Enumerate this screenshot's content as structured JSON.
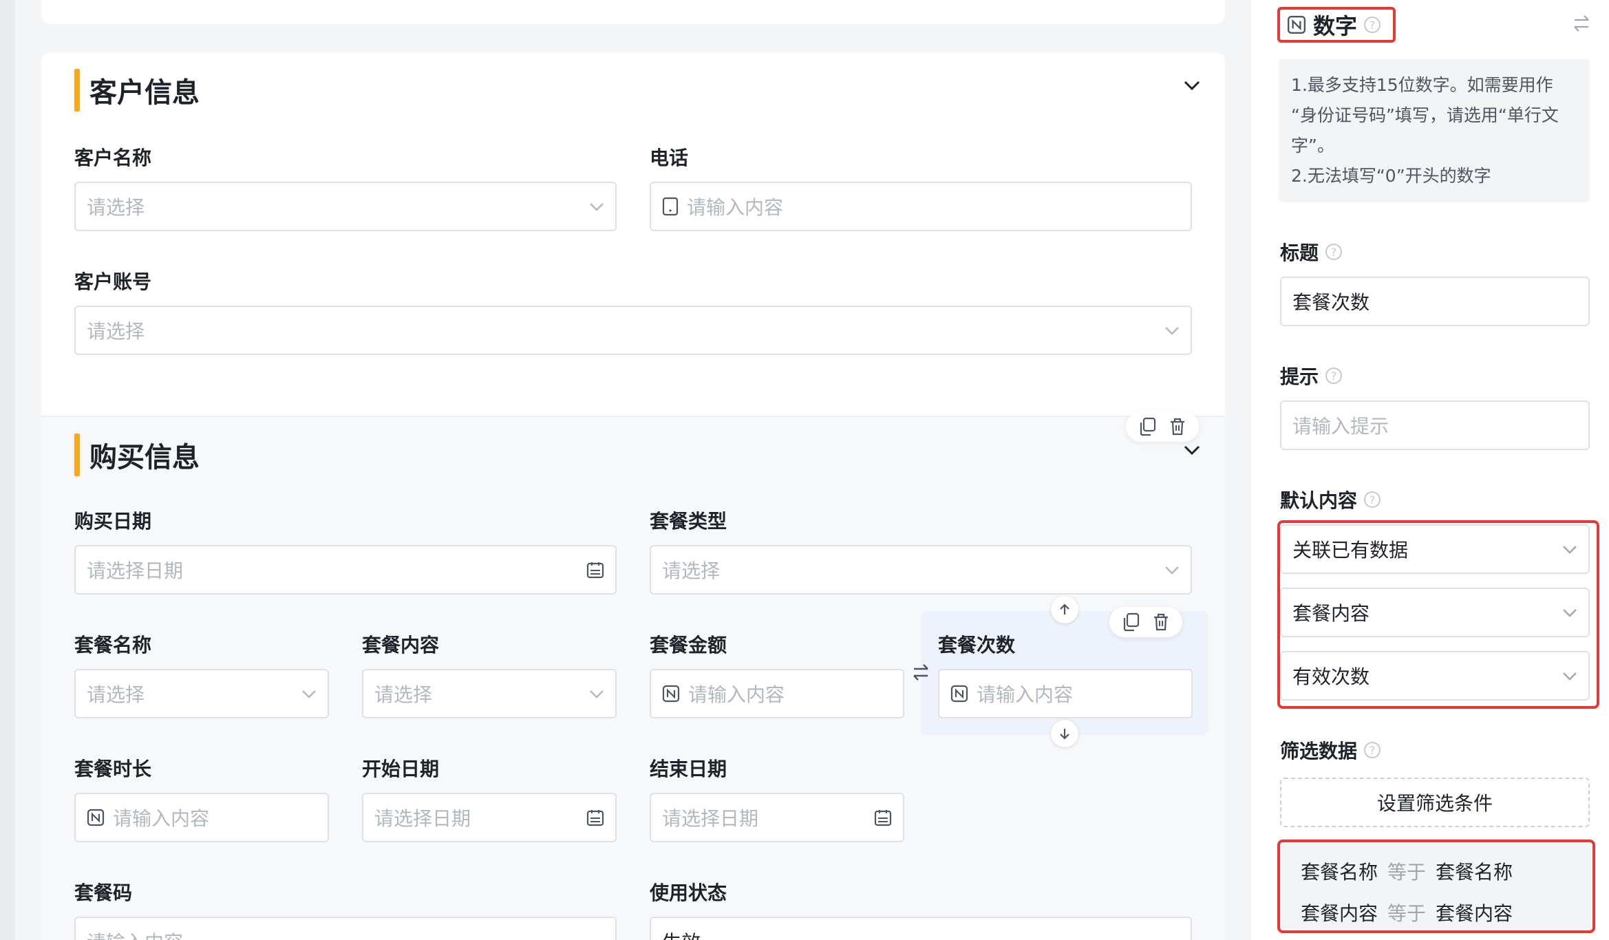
{
  "customer_section": {
    "title": "客户信息",
    "fields": {
      "customer_name": {
        "label": "客户名称",
        "placeholder": "请选择"
      },
      "phone": {
        "label": "电话",
        "placeholder": "请输入内容"
      },
      "customer_account": {
        "label": "客户账号",
        "placeholder": "请选择"
      }
    }
  },
  "purchase_section": {
    "title": "购买信息",
    "fields": {
      "purchase_date": {
        "label": "购买日期",
        "placeholder": "请选择日期"
      },
      "package_type": {
        "label": "套餐类型",
        "placeholder": "请选择"
      },
      "package_name": {
        "label": "套餐名称",
        "placeholder": "请选择"
      },
      "package_content": {
        "label": "套餐内容",
        "placeholder": "请选择"
      },
      "package_amount": {
        "label": "套餐金额",
        "placeholder": "请输入内容"
      },
      "package_count": {
        "label": "套餐次数",
        "placeholder": "请输入内容"
      },
      "package_duration": {
        "label": "套餐时长",
        "placeholder": "请输入内容"
      },
      "start_date": {
        "label": "开始日期",
        "placeholder": "请选择日期"
      },
      "end_date": {
        "label": "结束日期",
        "placeholder": "请选择日期"
      },
      "package_code": {
        "label": "套餐码",
        "placeholder": "请输入内容"
      },
      "usage_status": {
        "label": "使用状态",
        "value": "生效"
      }
    }
  },
  "panel": {
    "type_title": "数字",
    "tips": [
      "1.最多支持15位数字。如需要用作",
      "“身份证号码”填写，请选用“单行文",
      "字”。",
      "2.无法填写“0”开头的数字"
    ],
    "title_label": "标题",
    "title_value": "套餐次数",
    "hint_label": "提示",
    "hint_placeholder": "请输入提示",
    "default_label": "默认内容",
    "default_mode": "关联已有数据",
    "default_source": "套餐内容",
    "default_field": "有效次数",
    "filter_label": "筛选数据",
    "filter_button": "设置筛选条件",
    "conditions": [
      {
        "left": "套餐名称",
        "op": "等于",
        "right": "套餐名称"
      },
      {
        "left": "套餐内容",
        "op": "等于",
        "right": "套餐内容"
      }
    ]
  }
}
